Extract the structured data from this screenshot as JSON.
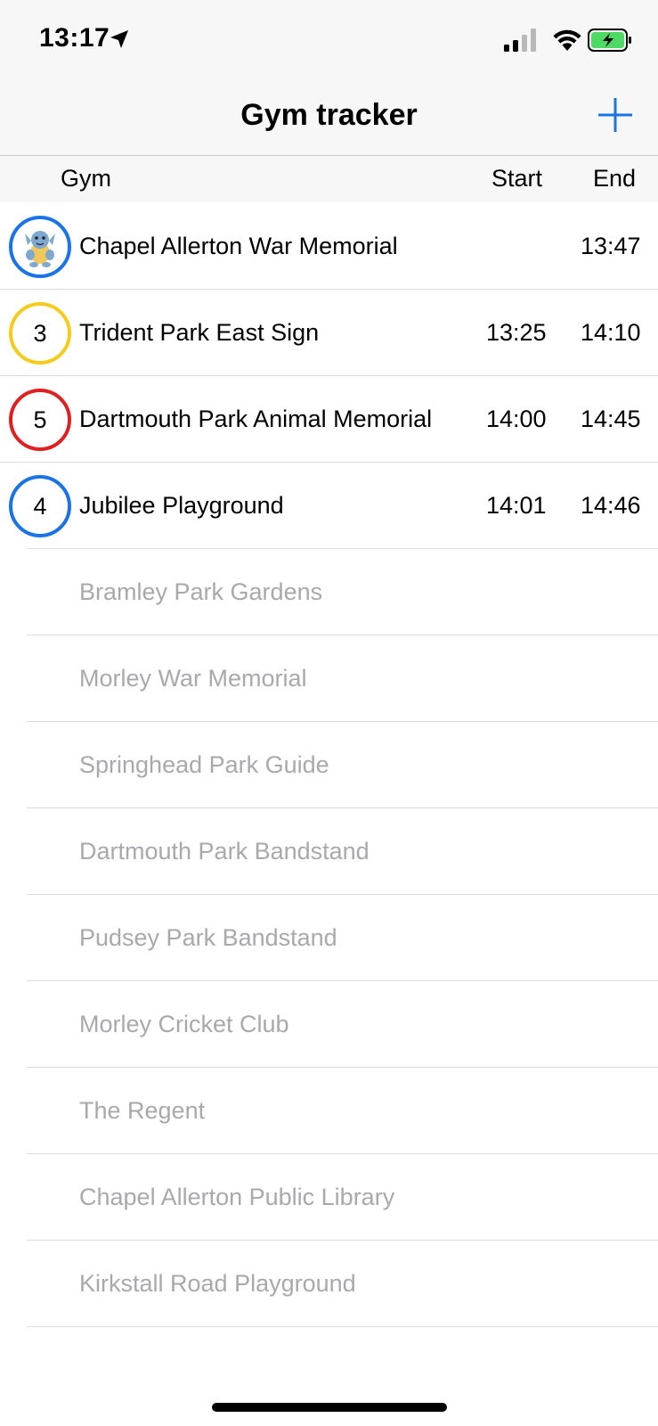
{
  "status": {
    "time": "13:17",
    "icons": [
      "location-arrow-icon",
      "cellular-signal-icon",
      "wifi-icon",
      "battery-charging-icon"
    ]
  },
  "nav": {
    "title": "Gym tracker",
    "add_icon": "plus-icon"
  },
  "columns": {
    "gym": "Gym",
    "start": "Start",
    "end": "End"
  },
  "colors": {
    "accent": "#1a73e8",
    "tier_yellow": "#f5cc1c",
    "tier_red": "#e02020",
    "tier_blue": "#1a73e8",
    "inactive_text": "#a9a9ad"
  },
  "active_gyms": [
    {
      "badge": "",
      "badge_icon": "pokemon-avatar-icon",
      "badge_color": "blue",
      "name": "Chapel Allerton War Memorial",
      "start": "",
      "end": "13:47"
    },
    {
      "badge": "3",
      "badge_color": "yellow",
      "name": "Trident Park East Sign",
      "start": "13:25",
      "end": "14:10"
    },
    {
      "badge": "5",
      "badge_color": "red",
      "name": "Dartmouth Park Animal Memorial",
      "start": "14:00",
      "end": "14:45"
    },
    {
      "badge": "4",
      "badge_color": "blue",
      "name": "Jubilee Playground",
      "start": "14:01",
      "end": "14:46"
    }
  ],
  "inactive_gyms": [
    "Bramley Park Gardens",
    "Morley War Memorial",
    "Springhead Park Guide",
    "Dartmouth Park Bandstand",
    "Pudsey Park Bandstand",
    "Morley Cricket Club",
    "The Regent",
    "Chapel Allerton Public Library",
    "Kirkstall Road Playground"
  ]
}
